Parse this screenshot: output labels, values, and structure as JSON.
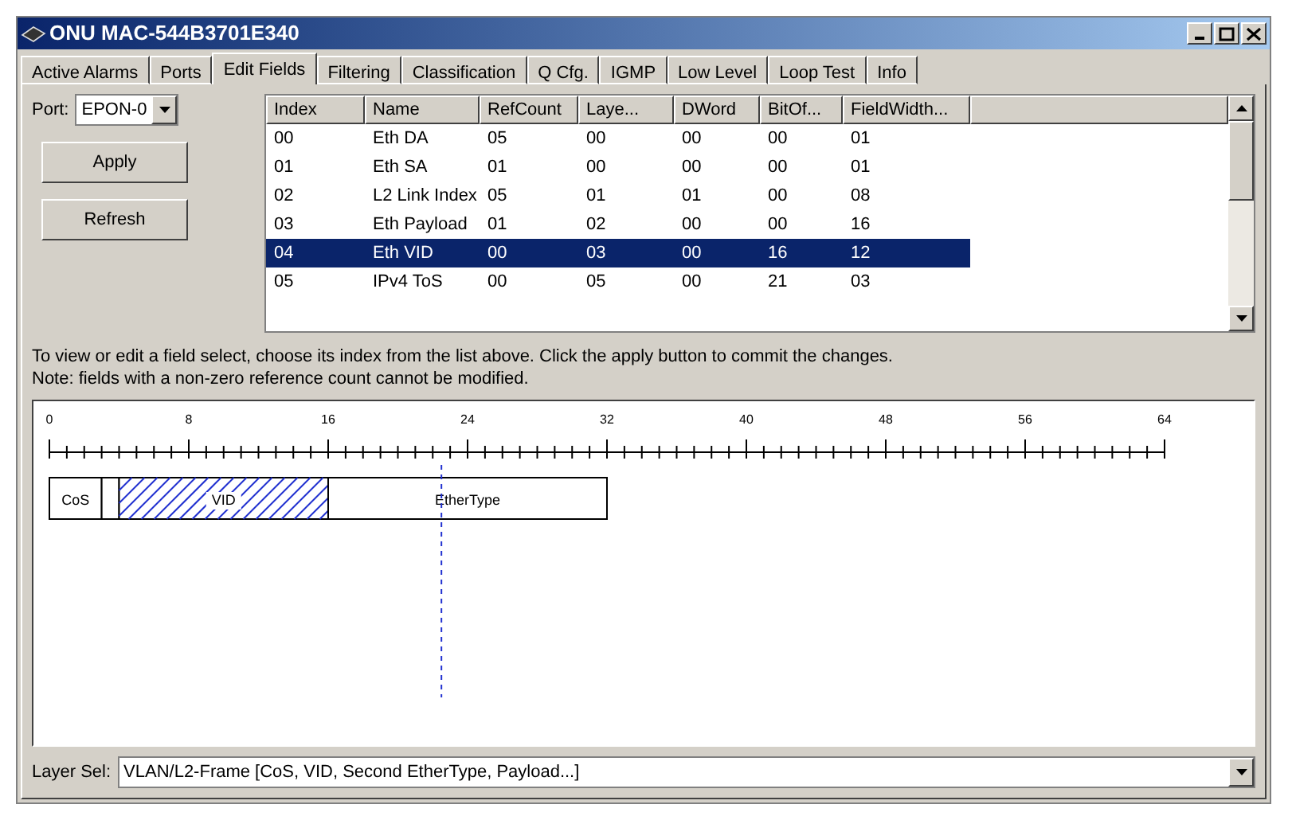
{
  "window": {
    "title": "ONU MAC-544B3701E340"
  },
  "tabs": [
    {
      "label": "Active Alarms",
      "selected": false
    },
    {
      "label": "Ports",
      "selected": false
    },
    {
      "label": "Edit Fields",
      "selected": true
    },
    {
      "label": "Filtering",
      "selected": false
    },
    {
      "label": "Classification",
      "selected": false
    },
    {
      "label": "Q Cfg.",
      "selected": false
    },
    {
      "label": "IGMP",
      "selected": false
    },
    {
      "label": "Low Level",
      "selected": false
    },
    {
      "label": "Loop Test",
      "selected": false
    },
    {
      "label": "Info",
      "selected": false
    }
  ],
  "port": {
    "label": "Port:",
    "value": "EPON-0"
  },
  "buttons": [
    "Apply",
    "Refresh"
  ],
  "table": {
    "columns": [
      "Index",
      "Name",
      "RefCount",
      "Laye...",
      "DWord",
      "BitOf...",
      "FieldWidth..."
    ],
    "rows": [
      {
        "cells": [
          "00",
          "Eth DA",
          "05",
          "00",
          "00",
          "00",
          "01"
        ],
        "selected": false
      },
      {
        "cells": [
          "01",
          "Eth SA",
          "01",
          "00",
          "00",
          "00",
          "01"
        ],
        "selected": false
      },
      {
        "cells": [
          "02",
          "L2 Link Index",
          "05",
          "01",
          "01",
          "00",
          "08"
        ],
        "selected": false
      },
      {
        "cells": [
          "03",
          "Eth Payload",
          "01",
          "02",
          "00",
          "00",
          "16"
        ],
        "selected": false
      },
      {
        "cells": [
          "04",
          "Eth VID",
          "00",
          "03",
          "00",
          "16",
          "12"
        ],
        "selected": true
      },
      {
        "cells": [
          "05",
          "IPv4 ToS",
          "00",
          "05",
          "00",
          "21",
          "03"
        ],
        "selected": false
      }
    ]
  },
  "help_text": [
    "To view or edit a field select, choose its index from the list above. Click the apply button to commit the changes.",
    "Note: fields with a non-zero reference count cannot be modified."
  ],
  "field_map": {
    "ticks": [
      "0",
      "8",
      "16",
      "24",
      "32",
      "40",
      "48",
      "56",
      "64"
    ],
    "fields": [
      {
        "label": "CoS",
        "selected": false
      },
      {
        "selected": false
      },
      {
        "label": "VID",
        "selected": true
      },
      {
        "label": "EtherType",
        "selected": false
      }
    ]
  },
  "layer_select": {
    "label": "Layer Sel:",
    "value": "VLAN/L2-Frame [CoS, VID, Second EtherType, Payload...]"
  }
}
